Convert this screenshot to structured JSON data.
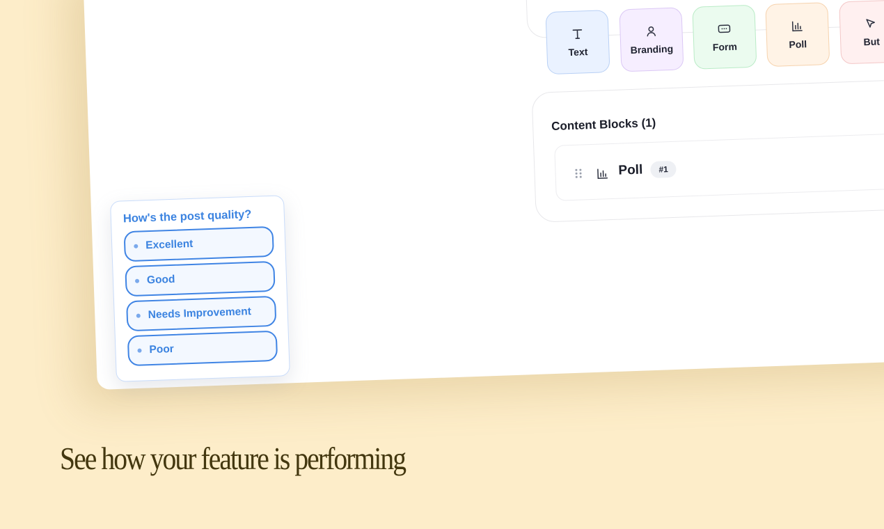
{
  "content_types": {
    "items": [
      {
        "label": "Text",
        "icon": "text-icon"
      },
      {
        "label": "Branding",
        "icon": "user-icon"
      },
      {
        "label": "Form",
        "icon": "form-icon"
      },
      {
        "label": "Poll",
        "icon": "bar-chart-icon"
      },
      {
        "label": "But",
        "icon": "cursor-icon"
      }
    ]
  },
  "content_blocks": {
    "title": "Content Blocks (1)",
    "rows": [
      {
        "name": "Poll",
        "badge": "#1",
        "icon": "bar-chart-icon"
      }
    ]
  },
  "poll_widget": {
    "question": "How's the post quality?",
    "options": [
      "Excellent",
      "Good",
      "Needs Improvement",
      "Poor"
    ]
  },
  "headline": "See how your feature is performing",
  "colors": {
    "background": "#fdedc9",
    "poll_accent": "#3b83e0",
    "headline": "#43370f"
  }
}
